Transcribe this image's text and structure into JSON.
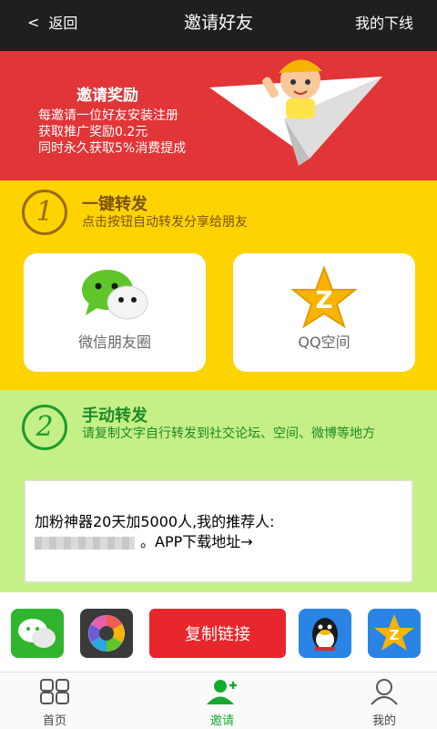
{
  "header": {
    "back_label": "返回",
    "title": "邀请好友",
    "right_label": "我的下线"
  },
  "banner": {
    "title": "邀请奖励",
    "lines": [
      "每邀请一位好友安装注册",
      "获取推广奖励0.2元",
      "同时永久获取5%消费提成"
    ]
  },
  "section1": {
    "number": "1",
    "title": "一键转发",
    "subtitle": "点击按钮自动转发分享给朋友",
    "cards": [
      {
        "label": "微信朋友圈",
        "icon": "wechat-moments-icon"
      },
      {
        "label": "QQ空间",
        "icon": "qzone-icon"
      }
    ]
  },
  "section2": {
    "number": "2",
    "title": "手动转发",
    "subtitle": "请复制文字自行转发到社交论坛、空间、微博等地方",
    "copy_text_line1": "加粉神器20天加5000人,我的推荐人:",
    "copy_text_line2": "。APP下载地址→"
  },
  "share_row": {
    "copy_button": "复制链接",
    "icons": [
      "wechat-icon",
      "moments-icon",
      "qq-icon",
      "qzone-icon"
    ]
  },
  "tabbar": {
    "tabs": [
      {
        "label": "首页",
        "icon": "grid-icon",
        "active": false
      },
      {
        "label": "邀请",
        "icon": "invite-user-icon",
        "active": true
      },
      {
        "label": "我的",
        "icon": "user-icon",
        "active": false
      }
    ]
  },
  "colors": {
    "accent_green": "#17a82e",
    "banner_red": "#e13538",
    "section1_yellow": "#ffd300",
    "section2_green": "#c5ef87",
    "button_red": "#e8262b"
  }
}
